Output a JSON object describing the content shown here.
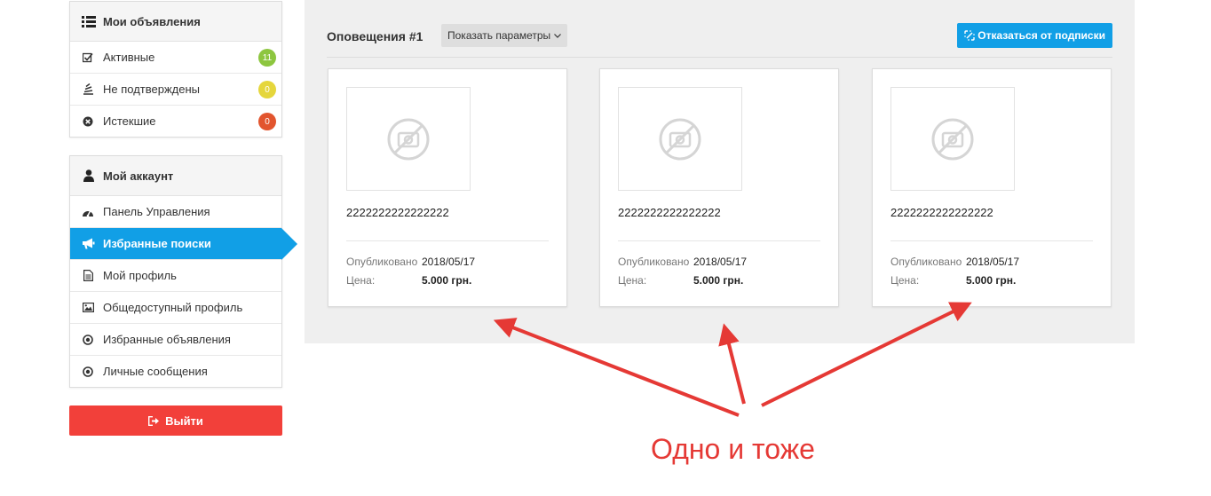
{
  "sidebar": {
    "my_ads": {
      "title": "Мои объявления",
      "title_icon": "list-icon",
      "items": [
        {
          "label": "Активные",
          "icon": "checkbox-icon",
          "badge": "11",
          "badge_color": "#8dc63f"
        },
        {
          "label": "Не подтверждены",
          "icon": "stack-icon",
          "badge": "0",
          "badge_color": "#e5d63c"
        },
        {
          "label": "Истекшие",
          "icon": "times-circle-icon",
          "badge": "0",
          "badge_color": "#e2552e"
        }
      ]
    },
    "account": {
      "title": "Мой аккаунт",
      "title_icon": "user-icon",
      "items": [
        {
          "label": "Панель Управления",
          "icon": "dashboard-icon"
        },
        {
          "label": "Избранные поиски",
          "icon": "bullhorn-icon",
          "active": true
        },
        {
          "label": "Мой профиль",
          "icon": "file-icon"
        },
        {
          "label": "Общедоступный профиль",
          "icon": "picture-icon"
        },
        {
          "label": "Избранные объявления",
          "icon": "dot-circle-icon"
        },
        {
          "label": "Личные сообщения",
          "icon": "dot-circle-icon"
        }
      ]
    },
    "logout_label": "Выйти",
    "accent_color": "#119fe6",
    "logout_color": "#f2403a"
  },
  "main": {
    "title": "Оповещения #1",
    "params_button": "Показать параметры",
    "unsubscribe_button": "Отказаться от подписки",
    "cards": [
      {
        "title": "2222222222222222",
        "published_label": "Опубликовано",
        "published_value": "2018/05/17",
        "price_label": "Цена:",
        "price_value": "5.000 грн."
      },
      {
        "title": "2222222222222222",
        "published_label": "Опубликовано",
        "published_value": "2018/05/17",
        "price_label": "Цена:",
        "price_value": "5.000 грн."
      },
      {
        "title": "2222222222222222",
        "published_label": "Опубликовано",
        "published_value": "2018/05/17",
        "price_label": "Цена:",
        "price_value": "5.000 грн."
      }
    ]
  },
  "annotation": {
    "text": "Одно и тоже",
    "color": "#e53935"
  }
}
